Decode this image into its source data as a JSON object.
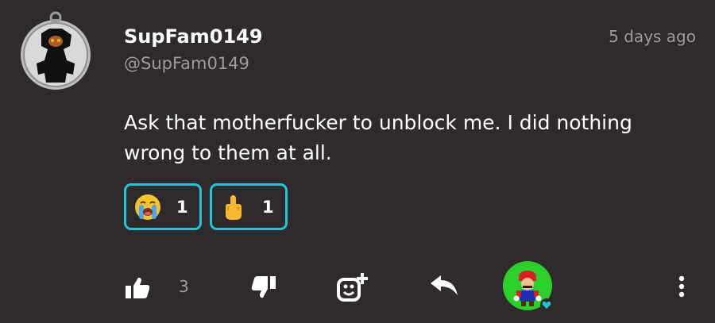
{
  "post": {
    "author": {
      "display_name": "SupFam0149",
      "handle": "@SupFam0149",
      "avatar_icon": "shadow-character-avatar"
    },
    "timestamp": "5 days ago",
    "text": "Ask that motherfucker to unblock me. I did nothing wrong to them at all.",
    "reactions": [
      {
        "icon": "crying-face-emoji",
        "count": "1"
      },
      {
        "icon": "middle-finger-emoji",
        "count": "1"
      }
    ],
    "actions": {
      "like_icon": "thumbs-up-icon",
      "like_count": "3",
      "dislike_icon": "thumbs-down-icon",
      "react_icon": "add-reaction-icon",
      "reply_icon": "reply-icon",
      "creator_badge_icon": "creator-heart-avatar",
      "more_icon": "more-vertical-icon"
    }
  },
  "colors": {
    "background": "#2f2a2b",
    "accent": "#22c7d6",
    "muted_text": "#a09a9b",
    "badge_green": "#2bd12b"
  }
}
